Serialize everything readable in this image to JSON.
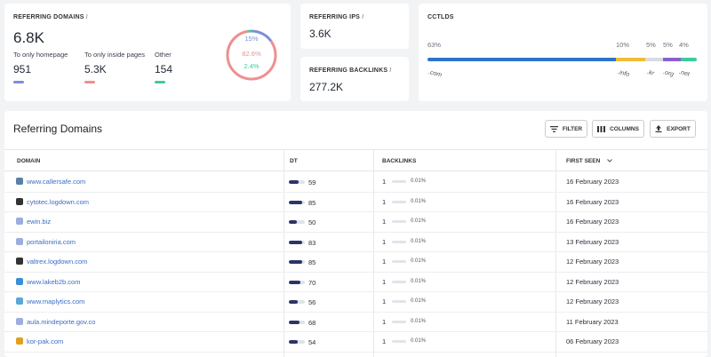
{
  "referring_domains": {
    "label": "REFERRING DOMAINS",
    "info": "i",
    "total": "6.8K",
    "breakdown": [
      {
        "label": "To only homepage",
        "value": "951",
        "color": "#7b8fd9"
      },
      {
        "label": "To only inside pages",
        "value": "5.3K",
        "color": "#ef8f8f"
      },
      {
        "label": "Other",
        "value": "154",
        "color": "#3fca9a"
      }
    ],
    "donut": [
      {
        "label": "15%",
        "percent": 15,
        "color": "#7b8fd9"
      },
      {
        "label": "82.6%",
        "percent": 82.6,
        "color": "#ef8f8f"
      },
      {
        "label": "2.4%",
        "percent": 2.4,
        "color": "#3fca9a"
      }
    ]
  },
  "referring_ips": {
    "label": "REFERRING IPS",
    "info": "i",
    "value": "3.6K"
  },
  "referring_backlinks": {
    "label": "REFERRING BACKLINKS",
    "info": "i",
    "value": "277.2K"
  },
  "cctlds": {
    "label": "CCTLDS",
    "items": [
      {
        "name": ".com",
        "percent_label": "63%",
        "share": 0.7,
        "color": "#2f73c9"
      },
      {
        "name": ".info",
        "percent_label": "10%",
        "share": 0.11,
        "color": "#f0bd3a"
      },
      {
        "name": ".kr",
        "percent_label": "5%",
        "share": 0.065,
        "color": "#d8dbe0"
      },
      {
        "name": ".org",
        "percent_label": "5%",
        "share": 0.065,
        "color": "#8a5fd1"
      },
      {
        "name": ".net",
        "percent_label": "4%",
        "share": 0.06,
        "color": "#3fca9a"
      }
    ]
  },
  "table": {
    "title": "Referring Domains",
    "buttons": {
      "filter": "FILTER",
      "columns": "COLUMNS",
      "export": "EXPORT"
    },
    "headers": {
      "domain": "DOMAIN",
      "dt": "DT",
      "backlinks": "BACKLINKS",
      "first_seen": "FIRST SEEN"
    },
    "rows": [
      {
        "domain": "www.callersafe.com",
        "dt": "59",
        "dt_level": 0.59,
        "backlinks": "1",
        "pct": "0.01%",
        "first_seen": "16 February 2023",
        "fav_color": "#5a7fa8"
      },
      {
        "domain": "cytotec.logdown.com",
        "dt": "85",
        "dt_level": 0.85,
        "backlinks": "1",
        "pct": "0.01%",
        "first_seen": "16 February 2023",
        "fav_color": "#333333"
      },
      {
        "domain": "ewin.biz",
        "dt": "50",
        "dt_level": 0.5,
        "backlinks": "1",
        "pct": "0.01%",
        "first_seen": "16 February 2023",
        "fav_color": "#9aaee0"
      },
      {
        "domain": "portailoniria.com",
        "dt": "83",
        "dt_level": 0.83,
        "backlinks": "1",
        "pct": "0.01%",
        "first_seen": "13 February 2023",
        "fav_color": "#9aaee0"
      },
      {
        "domain": "valtrex.logdown.com",
        "dt": "85",
        "dt_level": 0.85,
        "backlinks": "1",
        "pct": "0.01%",
        "first_seen": "12 February 2023",
        "fav_color": "#333333"
      },
      {
        "domain": "www.lakeb2b.com",
        "dt": "70",
        "dt_level": 0.7,
        "backlinks": "1",
        "pct": "0.01%",
        "first_seen": "12 February 2023",
        "fav_color": "#3a8fd6"
      },
      {
        "domain": "www.maplytics.com",
        "dt": "56",
        "dt_level": 0.56,
        "backlinks": "1",
        "pct": "0.01%",
        "first_seen": "12 February 2023",
        "fav_color": "#5aa8d8"
      },
      {
        "domain": "aula.mindeporte.gov.co",
        "dt": "68",
        "dt_level": 0.68,
        "backlinks": "1",
        "pct": "0.01%",
        "first_seen": "11 February 2023",
        "fav_color": "#9aaee0"
      },
      {
        "domain": "kor-pak.com",
        "dt": "54",
        "dt_level": 0.54,
        "backlinks": "1",
        "pct": "0.01%",
        "first_seen": "06 February 2023",
        "fav_color": "#e0a020"
      }
    ]
  }
}
